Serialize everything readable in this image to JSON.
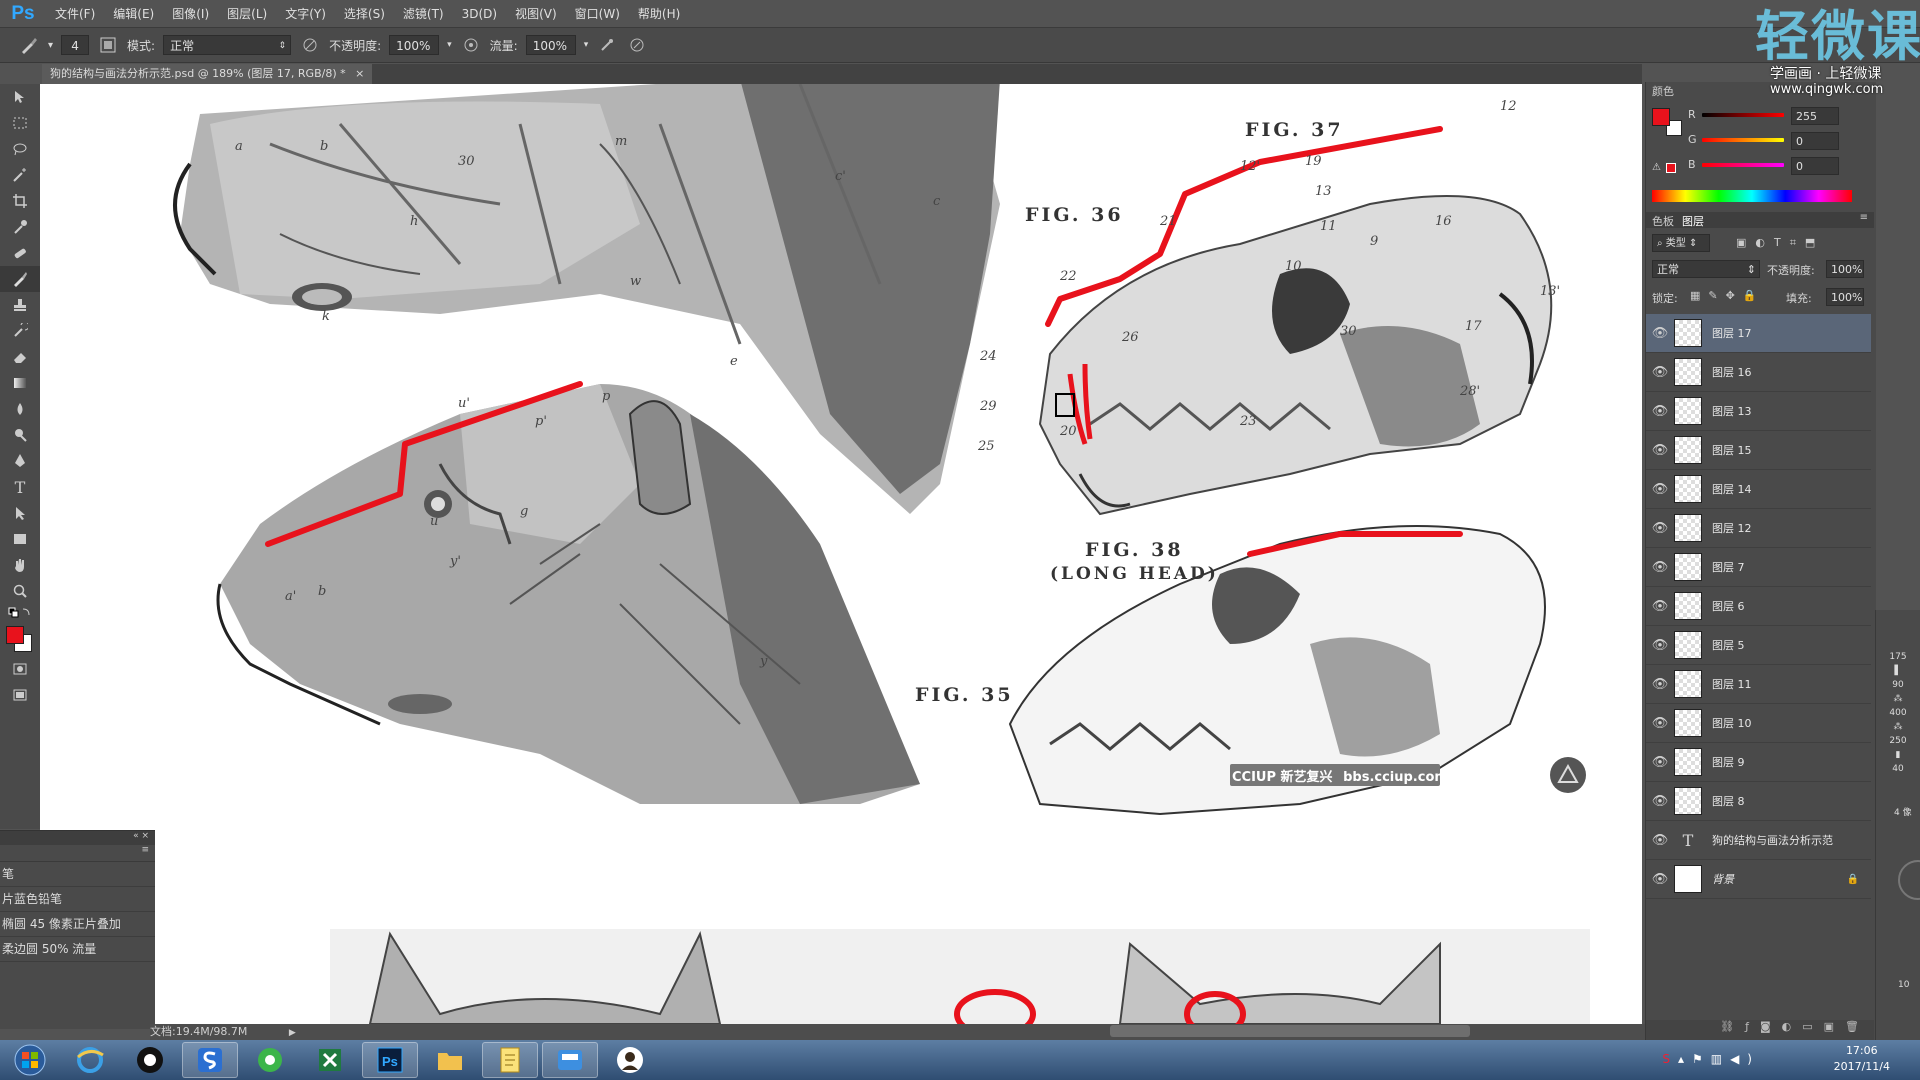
{
  "app": {
    "logo": "Ps",
    "menu": [
      "文件(F)",
      "编辑(E)",
      "图像(I)",
      "图层(L)",
      "文字(Y)",
      "选择(S)",
      "滤镜(T)",
      "3D(D)",
      "视图(V)",
      "窗口(W)",
      "帮助(H)"
    ]
  },
  "options": {
    "brush_size": "4",
    "mode_label": "模式:",
    "mode_value": "正常",
    "opacity_label": "不透明度:",
    "opacity_value": "100%",
    "flow_label": "流量:",
    "flow_value": "100%"
  },
  "document": {
    "tab_title": "狗的结构与画法分析示范.psd @ 189% (图层 17, RGB/8) *",
    "tab_close": "×",
    "status": "文档:19.4M/98.7M"
  },
  "canvas": {
    "fig_36": "FIG. 36",
    "fig_37": "FIG. 37",
    "fig_38": "FIG. 38",
    "fig_38_sub": "(LONG HEAD)",
    "fig_35": "FIG. 35",
    "credit": "CCIUP",
    "credit_cn": "新艺复兴",
    "credit_url": "bbs.cciup.com",
    "labels_skull": [
      "12'",
      "13",
      "11",
      "9",
      "16",
      "21",
      "22",
      "26",
      "10",
      "30",
      "23",
      "24",
      "20",
      "13'",
      "17",
      "29",
      "25",
      "28'",
      "19",
      "12"
    ],
    "labels_head": [
      "a",
      "b",
      "m",
      "30",
      "h",
      "c'",
      "c",
      "k",
      "w",
      "e",
      "u'",
      "p",
      "p'",
      "a'",
      "g",
      "u",
      "y",
      "b",
      "y'"
    ]
  },
  "brush_presets": {
    "items": [
      "笔",
      "片蓝色铅笔",
      "椭圆 45 像素正片叠加",
      "柔边圆 50% 流量"
    ]
  },
  "color_panel": {
    "tab": "颜色",
    "r_label": "R",
    "r_value": "255",
    "g_label": "G",
    "g_value": "0",
    "b_label": "B",
    "b_value": "0",
    "fg_color": "#e8121c",
    "bg_color": "#ffffff"
  },
  "layers_panel": {
    "tab_swatches": "色板",
    "tab_layers": "图层",
    "filter_type": "类型",
    "blend_mode": "正常",
    "opacity_label": "不透明度:",
    "opacity_value": "100%",
    "lock_label": "锁定:",
    "fill_label": "填充:",
    "fill_value": "100%",
    "layers": [
      "图层 17",
      "图层 16",
      "图层 13",
      "图层 15",
      "图层 14",
      "图层 12",
      "图层 7",
      "图层 6",
      "图层 5",
      "图层 11",
      "图层 10",
      "图层 9",
      "图层 8",
      "狗的结构与画法分析示范",
      "背景"
    ],
    "text_layer_icon": "T"
  },
  "side_strip": {
    "values": [
      "175",
      "90",
      "400",
      "250",
      "40"
    ],
    "brush_px": "4 像",
    "zoom": "10"
  },
  "watermark": {
    "title": "轻微课",
    "subtitle": "学画画 · 上轻微课",
    "url": "www.qingwk.com"
  },
  "taskbar": {
    "time": "17:06",
    "date": "2017/11/4",
    "colors": {
      "bar_top": "#5d7ea3",
      "bar_bottom": "#2f4d72"
    }
  }
}
